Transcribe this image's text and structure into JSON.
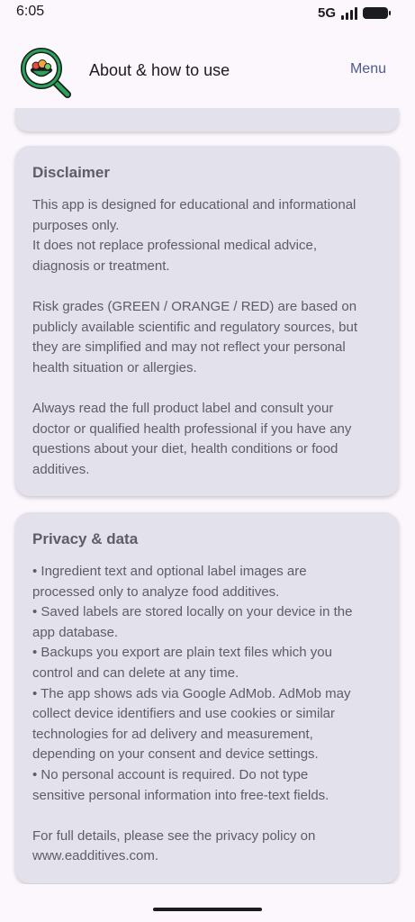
{
  "status_bar": {
    "time": "6:05",
    "network": "5G"
  },
  "app_bar": {
    "logo_icon": "food-magnifier-icon",
    "title": "About & how to use",
    "menu_label": "Menu",
    "accent_color": "#4b5a8f"
  },
  "disclaimer": {
    "title": "Disclaimer",
    "paragraphs": [
      {
        "lines": [
          "This app is designed for educational and informational",
          "purposes only.",
          "It does not replace professional medical advice,",
          "diagnosis or treatment."
        ]
      },
      {
        "lines": [
          "Risk grades (GREEN / ORANGE / RED) are based on",
          "publicly available scientific and regulatory sources, but",
          "they are simplified and may not reflect your personal",
          "health situation or allergies."
        ]
      },
      {
        "lines": [
          "Always read the full product label and consult your",
          "doctor or qualified health professional if you have any",
          "questions about your diet, health conditions or food",
          "additives."
        ]
      }
    ]
  },
  "privacy": {
    "title": "Privacy & data",
    "paragraphs": [
      {
        "lines": [
          "• Ingredient text and optional label images are",
          "processed only to analyze food additives.",
          "• Saved labels are stored locally on your device in the",
          "app database.",
          "• Backups you export are plain text files which you",
          "control and can delete at any time.",
          "• The app shows ads via Google AdMob. AdMob may",
          "collect device identifiers and use cookies or similar",
          "technologies for ad delivery and measurement,",
          "depending on your consent and device settings.",
          "• No personal account is required. Do not type",
          "sensitive personal information into free-text fields."
        ]
      },
      {
        "lines": [
          "For full details, please see the privacy policy on",
          "www.eadditives.com."
        ]
      }
    ]
  }
}
